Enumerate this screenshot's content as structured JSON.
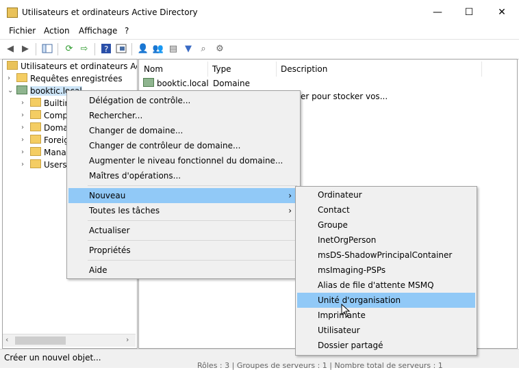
{
  "window": {
    "title": "Utilisateurs et ordinateurs Active Directory",
    "minimize": "—",
    "maximize": "☐",
    "close": "✕"
  },
  "menubar": [
    "Fichier",
    "Action",
    "Affichage",
    "?"
  ],
  "tree": {
    "root": "Utilisateurs et ordinateurs Active",
    "saved": "Requêtes enregistrées",
    "domain": "booktic.local",
    "children": [
      "Builtin",
      "Comp",
      "Doma",
      "Foreig",
      "Mana",
      "Users"
    ]
  },
  "list": {
    "columns": [
      "Nom",
      "Type",
      "Description"
    ],
    "rows": [
      {
        "name": "booktic.local",
        "type": "Domaine",
        "description": ""
      }
    ],
    "partial_text": "er pour stocker vos..."
  },
  "context_menu": {
    "items": [
      "Délégation de contrôle...",
      "Rechercher...",
      "Changer de domaine...",
      "Changer de contrôleur de domaine...",
      "Augmenter le niveau fonctionnel du domaine...",
      "Maîtres d'opérations...",
      "Nouveau",
      "Toutes les tâches",
      "Actualiser",
      "Propriétés",
      "Aide"
    ],
    "highlighted": "Nouveau"
  },
  "submenu": {
    "items": [
      "Ordinateur",
      "Contact",
      "Groupe",
      "InetOrgPerson",
      "msDS-ShadowPrincipalContainer",
      "msImaging-PSPs",
      "Alias de file d'attente MSMQ",
      "Unité d'organisation",
      "Imprimante",
      "Utilisateur",
      "Dossier partagé"
    ],
    "highlighted": "Unité d'organisation"
  },
  "status": {
    "text": "Créer un nouvel objet..."
  },
  "behind": {
    "text": "Rôles : 3   |   Groupes de serveurs : 1   |   Nombre total de serveurs : 1"
  }
}
